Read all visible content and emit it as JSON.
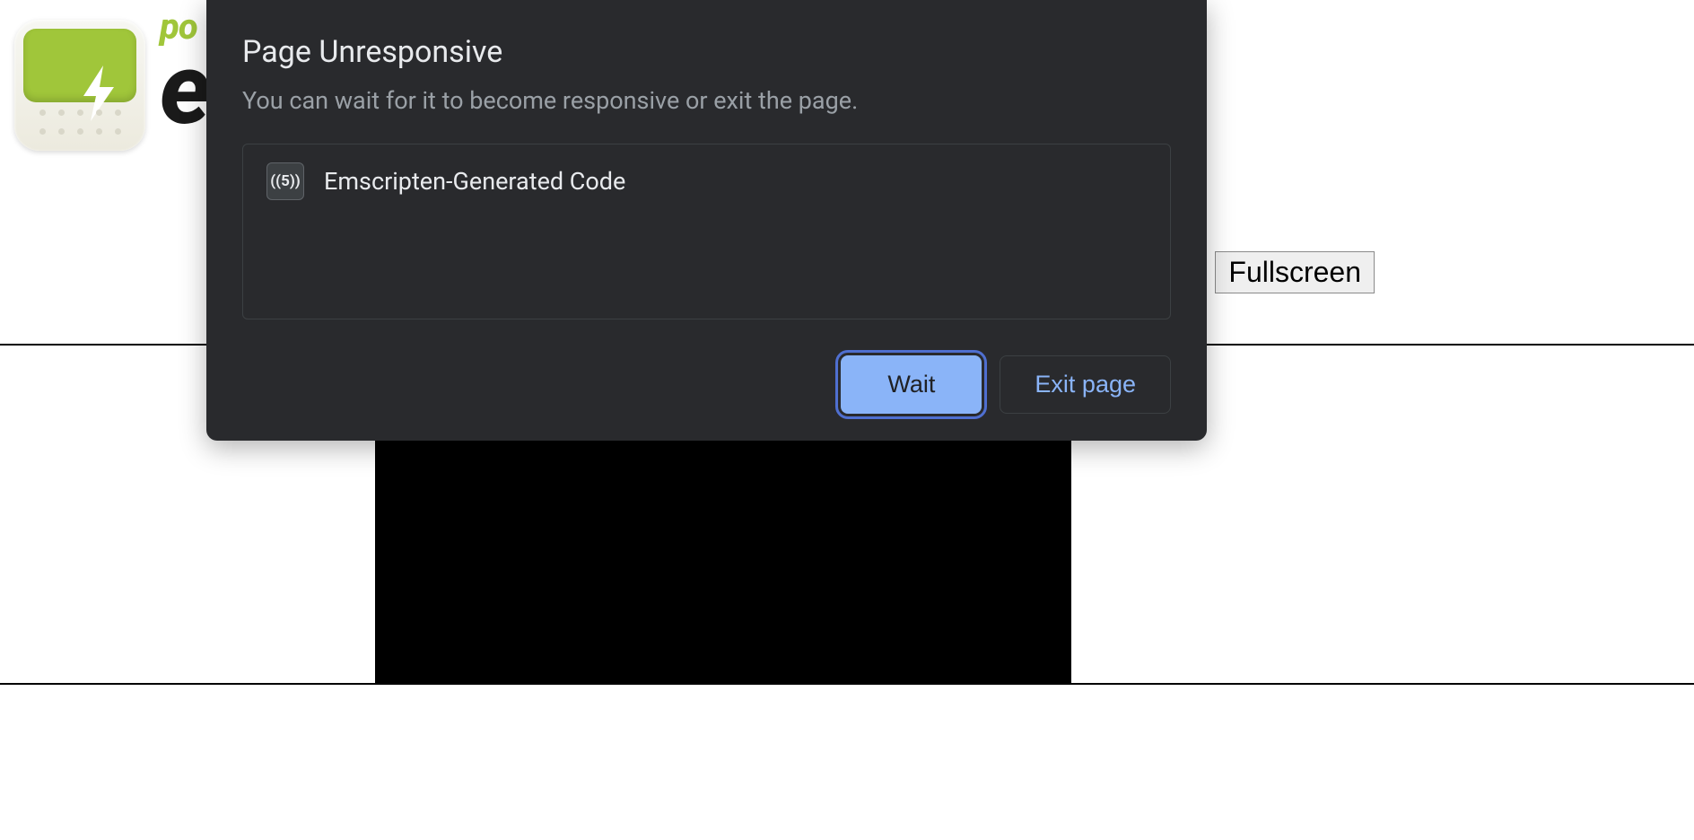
{
  "page": {
    "wordmark_small": "po",
    "wordmark_big": "e",
    "fullscreen_label": "Fullscreen"
  },
  "dialog": {
    "title": "Page Unresponsive",
    "subtitle": "You can wait for it to become responsive or exit the page.",
    "items": [
      {
        "favicon_text": "((5))",
        "label": "Emscripten-Generated Code"
      }
    ],
    "wait_label": "Wait",
    "exit_label": "Exit page"
  }
}
